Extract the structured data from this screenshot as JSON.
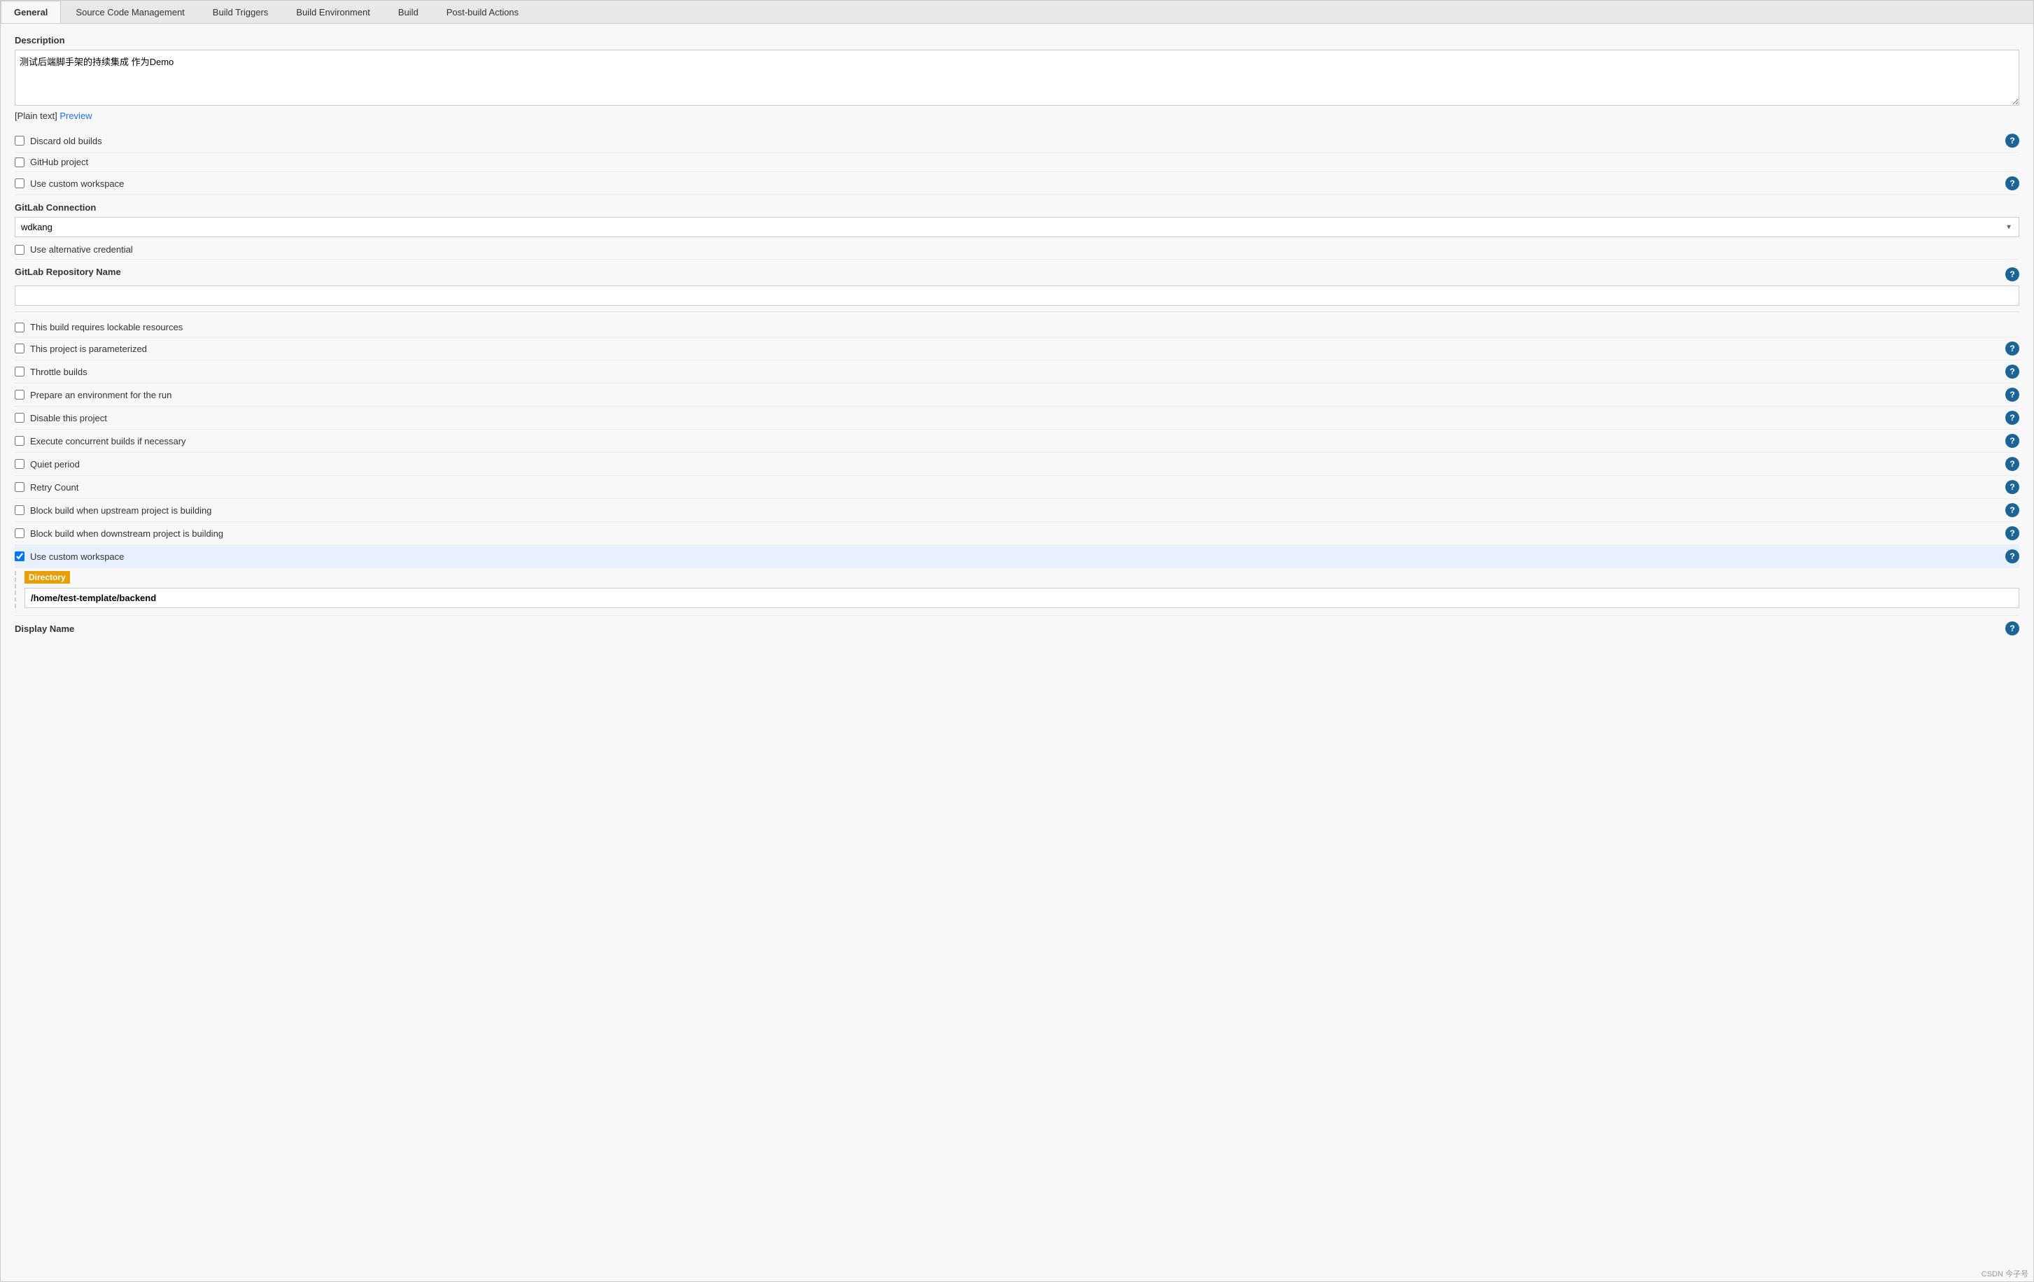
{
  "tabs": [
    {
      "id": "general",
      "label": "General",
      "active": true
    },
    {
      "id": "scm",
      "label": "Source Code Management",
      "active": false
    },
    {
      "id": "build-triggers",
      "label": "Build Triggers",
      "active": false
    },
    {
      "id": "build-env",
      "label": "Build Environment",
      "active": false
    },
    {
      "id": "build",
      "label": "Build",
      "active": false
    },
    {
      "id": "post-build",
      "label": "Post-build Actions",
      "active": false
    }
  ],
  "description": {
    "label": "Description",
    "value": "测试后端脚手架的持续集成 作为Demo",
    "plain_text_label": "[Plain text]",
    "preview_label": "Preview"
  },
  "checkboxes": [
    {
      "id": "discard-old-builds",
      "label": "Discard old builds",
      "checked": false,
      "has_help": true
    },
    {
      "id": "github-project",
      "label": "GitHub project",
      "checked": false,
      "has_help": false
    },
    {
      "id": "use-custom-workspace-1",
      "label": "Use custom workspace",
      "checked": false,
      "has_help": true
    }
  ],
  "gitlab_connection": {
    "label": "GitLab Connection",
    "selected_value": "wdkang",
    "options": [
      "wdkang"
    ]
  },
  "use_alternative_credential": {
    "label": "Use alternative credential",
    "checked": false
  },
  "gitlab_repo": {
    "label": "GitLab Repository Name",
    "value": "",
    "has_help": true
  },
  "checkboxes2": [
    {
      "id": "lockable-resources",
      "label": "This build requires lockable resources",
      "checked": false,
      "has_help": false
    },
    {
      "id": "parameterized",
      "label": "This project is parameterized",
      "checked": false,
      "has_help": true
    },
    {
      "id": "throttle-builds",
      "label": "Throttle builds",
      "checked": false,
      "has_help": true
    },
    {
      "id": "prepare-env",
      "label": "Prepare an environment for the run",
      "checked": false,
      "has_help": true
    },
    {
      "id": "disable-project",
      "label": "Disable this project",
      "checked": false,
      "has_help": true
    },
    {
      "id": "concurrent-builds",
      "label": "Execute concurrent builds if necessary",
      "checked": false,
      "has_help": true
    },
    {
      "id": "quiet-period",
      "label": "Quiet period",
      "checked": false,
      "has_help": true
    },
    {
      "id": "retry-count",
      "label": "Retry Count",
      "checked": false,
      "has_help": true
    },
    {
      "id": "block-upstream",
      "label": "Block build when upstream project is building",
      "checked": false,
      "has_help": true
    },
    {
      "id": "block-downstream",
      "label": "Block build when downstream project is building",
      "checked": false,
      "has_help": true
    },
    {
      "id": "use-custom-workspace-2",
      "label": "Use custom workspace",
      "checked": true,
      "has_help": true
    }
  ],
  "directory": {
    "label": "Directory",
    "value": "/home/test-template/backend"
  },
  "display_name": {
    "label": "Display Name",
    "has_help": true
  },
  "watermark": "CSDN 今子号"
}
